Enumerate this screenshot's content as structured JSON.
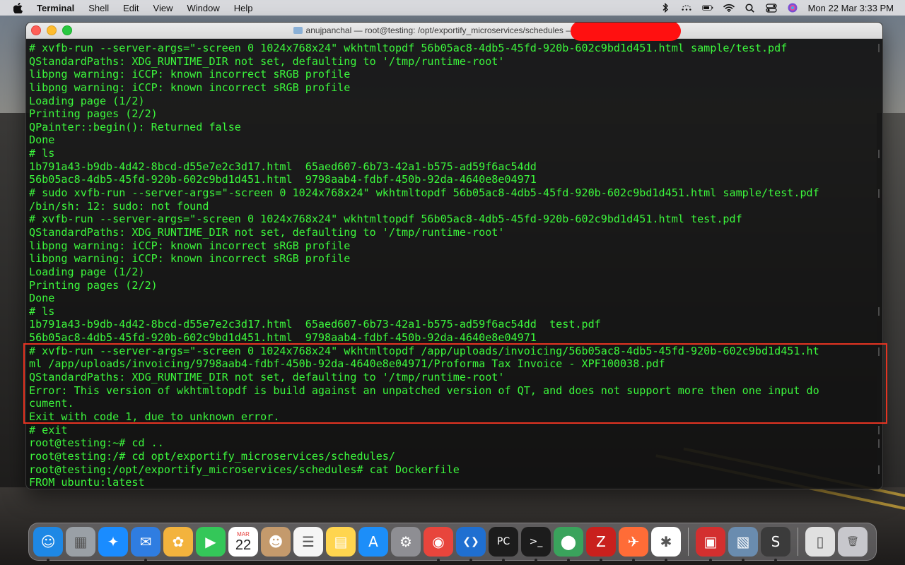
{
  "menubar": {
    "app_name": "Terminal",
    "items": [
      "Shell",
      "Edit",
      "View",
      "Window",
      "Help"
    ],
    "clock": "Mon 22 Mar  3:33 PM",
    "status_icons": [
      "bluetooth-icon",
      "wifi-dots-icon",
      "battery-icon",
      "wifi-icon",
      "search-icon",
      "control-center-icon",
      "siri-icon"
    ]
  },
  "window": {
    "title": "anujpanchal — root@testing: /opt/exportify_microservices/schedules — ssh root@"
  },
  "terminal": {
    "lines": [
      "# xvfb-run --server-args=\"-screen 0 1024x768x24\" wkhtmltopdf 56b05ac8-4db5-45fd-920b-602c9bd1d451.html sample/test.pdf",
      "QStandardPaths: XDG_RUNTIME_DIR not set, defaulting to '/tmp/runtime-root'",
      "libpng warning: iCCP: known incorrect sRGB profile",
      "libpng warning: iCCP: known incorrect sRGB profile",
      "Loading page (1/2)",
      "Printing pages (2/2)",
      "QPainter::begin(): Returned false",
      "Done",
      "# ls",
      "1b791a43-b9db-4d42-8bcd-d55e7e2c3d17.html  65aed607-6b73-42a1-b575-ad59f6ac54dd",
      "56b05ac8-4db5-45fd-920b-602c9bd1d451.html  9798aab4-fdbf-450b-92da-4640e8e04971",
      "# sudo xvfb-run --server-args=\"-screen 0 1024x768x24\" wkhtmltopdf 56b05ac8-4db5-45fd-920b-602c9bd1d451.html sample/test.pdf",
      "/bin/sh: 12: sudo: not found",
      "# xvfb-run --server-args=\"-screen 0 1024x768x24\" wkhtmltopdf 56b05ac8-4db5-45fd-920b-602c9bd1d451.html test.pdf",
      "QStandardPaths: XDG_RUNTIME_DIR not set, defaulting to '/tmp/runtime-root'",
      "libpng warning: iCCP: known incorrect sRGB profile",
      "libpng warning: iCCP: known incorrect sRGB profile",
      "Loading page (1/2)",
      "Printing pages (2/2)",
      "Done",
      "# ls",
      "1b791a43-b9db-4d42-8bcd-d55e7e2c3d17.html  65aed607-6b73-42a1-b575-ad59f6ac54dd  test.pdf",
      "56b05ac8-4db5-45fd-920b-602c9bd1d451.html  9798aab4-fdbf-450b-92da-4640e8e04971",
      "# xvfb-run --server-args=\"-screen 0 1024x768x24\" wkhtmltopdf /app/uploads/invoicing/56b05ac8-4db5-45fd-920b-602c9bd1d451.ht",
      "ml /app/uploads/invoicing/9798aab4-fdbf-450b-92da-4640e8e04971/Proforma Tax Invoice - XPF100038.pdf",
      "QStandardPaths: XDG_RUNTIME_DIR not set, defaulting to '/tmp/runtime-root'",
      "Error: This version of wkhtmltopdf is build against an unpatched version of QT, and does not support more then one input do",
      "cument.",
      "Exit with code 1, due to unknown error.",
      "# exit",
      "root@testing:~# cd ..",
      "root@testing:/# cd opt/exportify_microservices/schedules/",
      "root@testing:/opt/exportify_microservices/schedules# cat Dockerfile",
      "FROM ubuntu:latest"
    ]
  },
  "dock": {
    "calendar_month": "MAR",
    "calendar_day": "22",
    "apps": [
      {
        "name": "finder",
        "glyph": "☺",
        "color": "#1e88e5"
      },
      {
        "name": "launchpad",
        "glyph": "▦",
        "color": "#9aa0a6"
      },
      {
        "name": "safari",
        "glyph": "✦",
        "color": "#1a8cff"
      },
      {
        "name": "mail",
        "glyph": "✉",
        "color": "#2f7de1"
      },
      {
        "name": "photos",
        "glyph": "✿",
        "color": "#f3b33d"
      },
      {
        "name": "facetime",
        "glyph": "▶",
        "color": "#34c759"
      },
      {
        "name": "calendar",
        "glyph": "",
        "color": "#ffffff"
      },
      {
        "name": "contacts",
        "glyph": "☻",
        "color": "#c49a6c"
      },
      {
        "name": "reminders",
        "glyph": "☰",
        "color": "#f5f5f5"
      },
      {
        "name": "notes",
        "glyph": "▤",
        "color": "#ffd54f"
      },
      {
        "name": "app-store",
        "glyph": "A",
        "color": "#1c8ef9"
      },
      {
        "name": "system-preferences",
        "glyph": "⚙",
        "color": "#8e8e93"
      },
      {
        "name": "chrome",
        "glyph": "◉",
        "color": "#e8453c"
      },
      {
        "name": "vscode",
        "glyph": "❮❯",
        "color": "#1f6fd1"
      },
      {
        "name": "pycharm",
        "glyph": "PC",
        "color": "#1c1c1c"
      },
      {
        "name": "terminal",
        "glyph": ">_",
        "color": "#1c1c1c"
      },
      {
        "name": "sourcetree",
        "glyph": "⬤",
        "color": "#3aa35c"
      },
      {
        "name": "filezilla",
        "glyph": "Z",
        "color": "#c9201d"
      },
      {
        "name": "postman",
        "glyph": "✈",
        "color": "#ff6c37"
      },
      {
        "name": "slack",
        "glyph": "✱",
        "color": "#ffffff"
      },
      {
        "name": "photo-booth",
        "glyph": "▣",
        "color": "#d32f2f"
      },
      {
        "name": "preview",
        "glyph": "▧",
        "color": "#6a8caf"
      },
      {
        "name": "sublime-text",
        "glyph": "S",
        "color": "#3b3b3b"
      },
      {
        "name": "downloads-stack",
        "glyph": "▯",
        "color": "#e0e0e0"
      },
      {
        "name": "trash",
        "glyph": "🗑",
        "color": "#c7c7cc"
      }
    ]
  }
}
